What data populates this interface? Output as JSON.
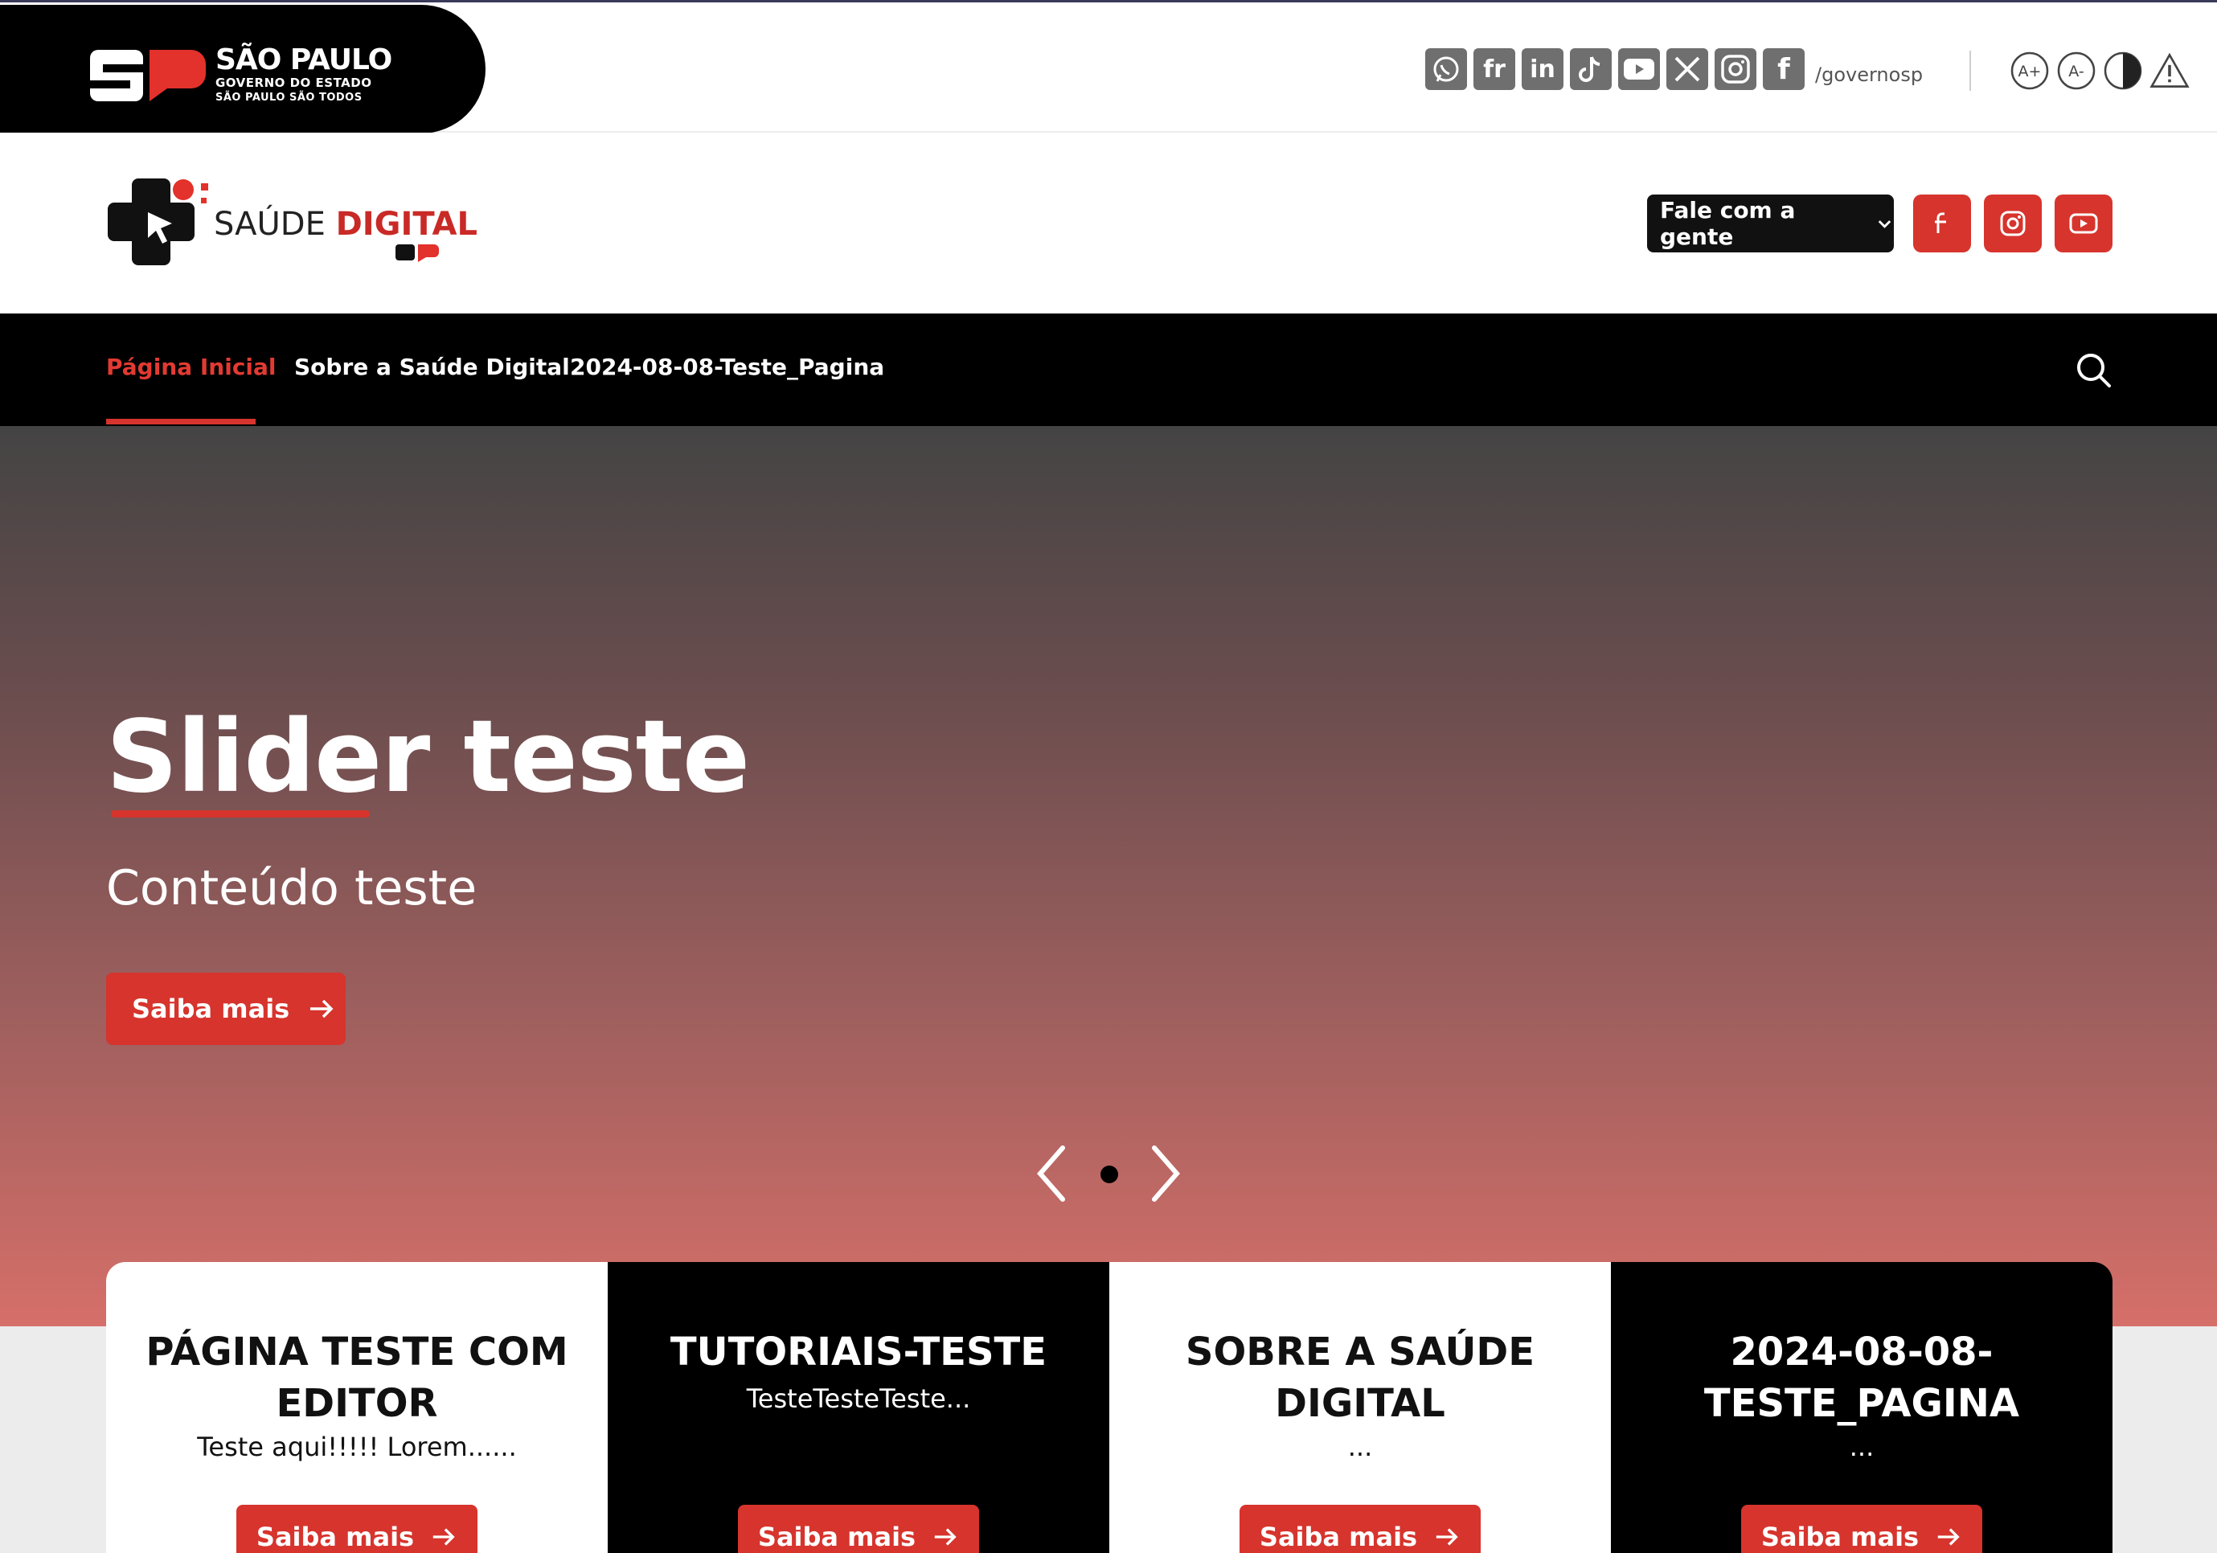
{
  "gov_bar": {
    "title": "SÃO PAULO",
    "subtitle1": "GOVERNO DO ESTADO",
    "subtitle2": "SÃO PAULO SÃO TODOS",
    "social_icons": [
      "whatsapp-icon",
      "flickr-icon",
      "linkedin-icon",
      "tiktok-icon",
      "youtube-icon",
      "x-icon",
      "instagram-icon",
      "facebook-icon"
    ],
    "handle": "/governosp",
    "accessibility_icons": [
      "increase-font-icon",
      "decrease-font-icon",
      "contrast-icon",
      "alert-icon"
    ],
    "accessibility_labels": {
      "increase": "A+",
      "decrease": "A-"
    }
  },
  "header": {
    "logo_text": "SAÚDE",
    "logo_text_bold": "DIGITAL",
    "fale_label": "Fale com a gente",
    "social_buttons": [
      "facebook-icon",
      "instagram-icon",
      "youtube-icon"
    ]
  },
  "nav": {
    "items": [
      {
        "label": "Página Inicial",
        "active": true
      },
      {
        "label": "Sobre a Saúde Digital",
        "active": false
      },
      {
        "label": "2024-08-08-Teste_Pagina",
        "active": false
      }
    ]
  },
  "hero": {
    "title": "Slider teste",
    "subtitle": "Conteúdo teste",
    "button_label": "Saiba mais",
    "slide_count": 1,
    "active_slide": 1
  },
  "cards": [
    {
      "title_line1": "PÁGINA TESTE COM",
      "title_line2": "EDITOR",
      "desc": "Teste aqui!!!!! Lorem......",
      "button": "Saiba mais",
      "theme": "light"
    },
    {
      "title_line1": "TUTORIAIS-TESTE",
      "title_line2": "",
      "desc": "TesteTesteTeste...",
      "button": "Saiba mais",
      "theme": "dark"
    },
    {
      "title_line1": "SOBRE A SAÚDE",
      "title_line2": "DIGITAL",
      "desc": "...",
      "button": "Saiba mais",
      "theme": "light"
    },
    {
      "title_line1": "2024-08-08-",
      "title_line2": "TESTE_PAGINA",
      "desc": "...",
      "button": "Saiba mais",
      "theme": "dark"
    }
  ],
  "colors": {
    "brand_red": "#d6342d",
    "nav_active": "#e23a32",
    "black": "#000000"
  }
}
